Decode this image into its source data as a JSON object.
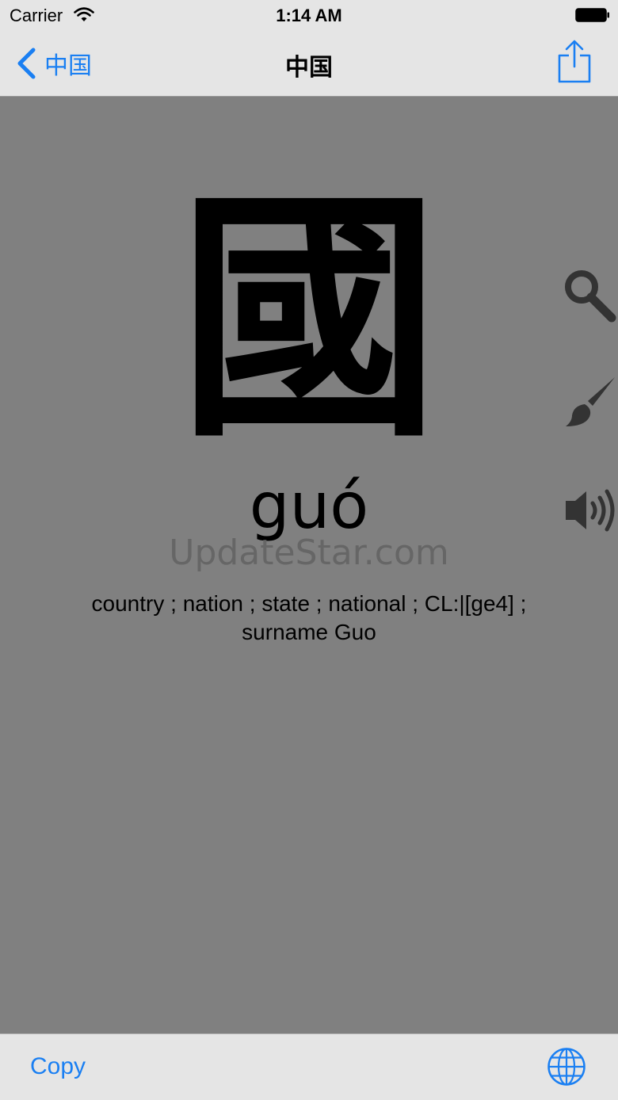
{
  "status_bar": {
    "carrier": "Carrier",
    "time": "1:14 AM"
  },
  "nav": {
    "back_label": "中国",
    "title": "中国"
  },
  "character": {
    "hanzi": "國",
    "pinyin": "guó",
    "definition_line1": "country ; nation ; state ; national ; CL:|[ge4] ;",
    "definition_line2": "surname Guo"
  },
  "watermark": "UpdateStar.com",
  "side_icons": [
    "search-icon",
    "brush-icon",
    "speaker-icon"
  ],
  "toolbar": {
    "copy_label": "Copy"
  },
  "colors": {
    "accent": "#1a7ff2",
    "background": "#808080",
    "bars": "#e5e5e5"
  }
}
